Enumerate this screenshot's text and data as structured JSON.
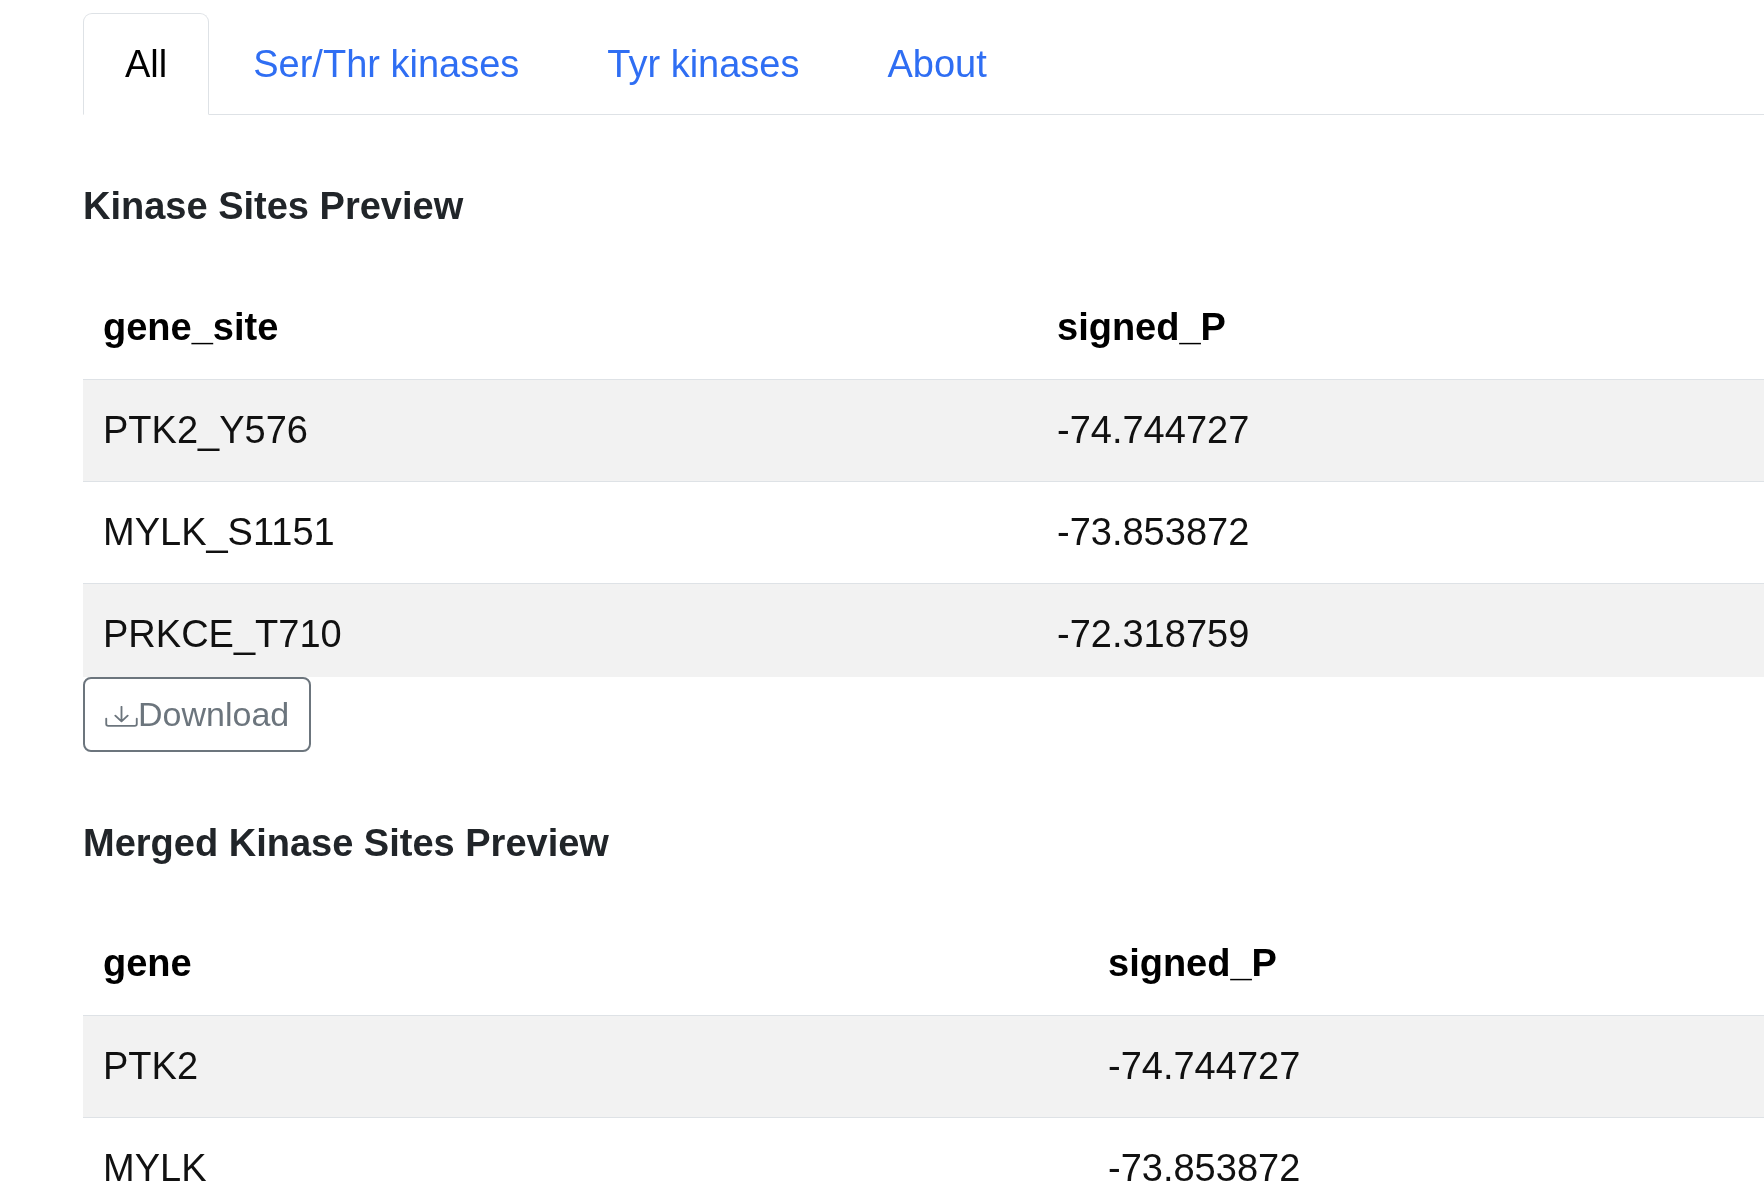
{
  "tabs": [
    {
      "label": "All",
      "selected": true
    },
    {
      "label": "Ser/Thr kinases",
      "selected": false
    },
    {
      "label": "Tyr kinases",
      "selected": false
    },
    {
      "label": "About",
      "selected": false
    }
  ],
  "sections": [
    {
      "title": "Kinase Sites Preview",
      "table": {
        "columns": [
          "gene_site",
          "signed_P"
        ],
        "rows": [
          [
            "PTK2_Y576",
            "-74.744727"
          ],
          [
            "MYLK_S1151",
            "-73.853872"
          ],
          [
            "PRKCE_T710",
            "-72.318759"
          ]
        ]
      },
      "download_button": "Download"
    },
    {
      "title": "Merged Kinase Sites Preview",
      "table": {
        "columns": [
          "gene",
          "signed_P"
        ],
        "rows": [
          [
            "PTK2",
            "-74.744727"
          ],
          [
            "MYLK",
            "-73.853872"
          ]
        ]
      }
    }
  ]
}
